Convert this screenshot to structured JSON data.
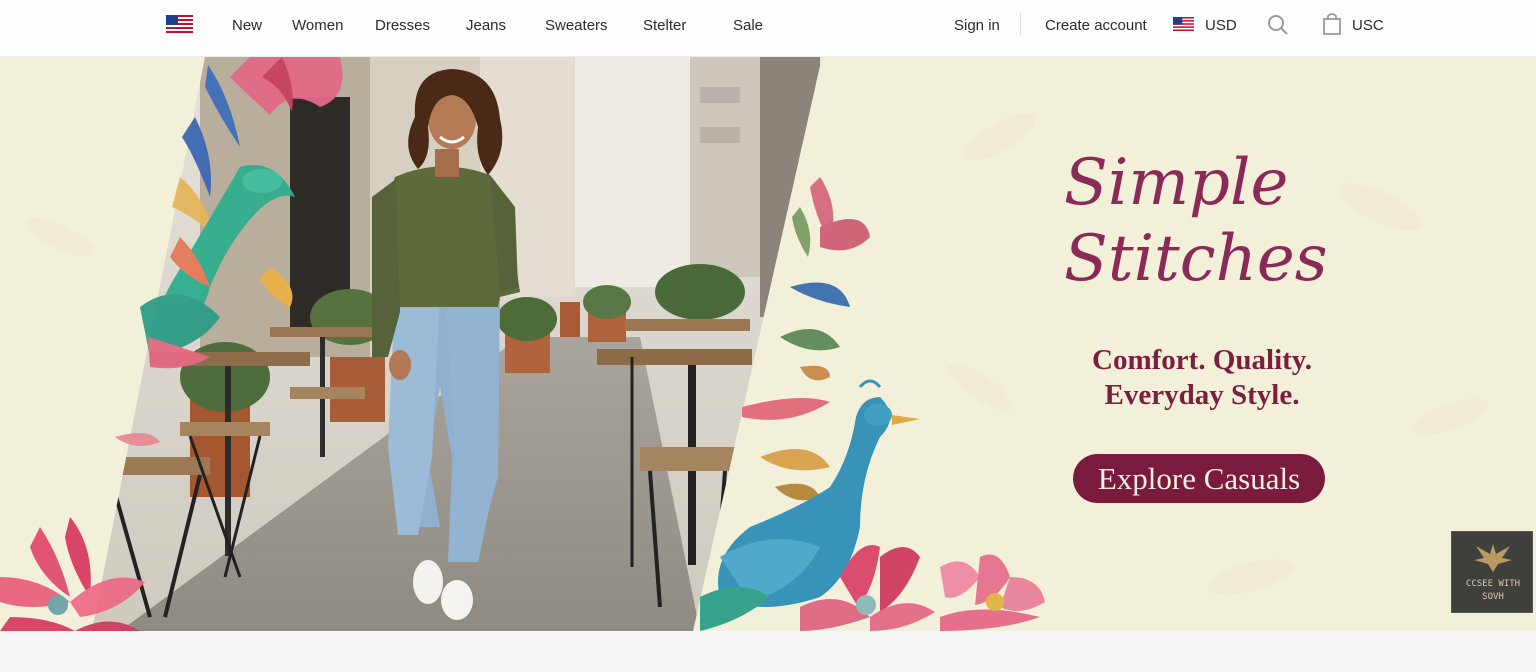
{
  "header": {
    "locale_flag": "us-flag-icon",
    "nav": [
      {
        "label": "New"
      },
      {
        "label": "Women"
      },
      {
        "label": "Dresses"
      },
      {
        "label": "Jeans"
      },
      {
        "label": "Sweaters"
      },
      {
        "label": "Stelter"
      },
      {
        "label": "Sale"
      }
    ],
    "sign_in": "Sign in",
    "create_account": "Create account",
    "currency": "USD",
    "search_icon": "search-icon",
    "bag_icon": "shopping-bag-icon",
    "bag_label": "USC"
  },
  "hero": {
    "title_line1": "Simple",
    "title_line2": "Stitches",
    "tagline_line1": "Comfort. Quality.",
    "tagline_line2": "Everyday Style.",
    "cta_label": "Explore Casuals",
    "colors": {
      "background": "#f3f0da",
      "title": "#8a2a56",
      "tagline": "#7a1f3f",
      "cta": "#7a1a3d"
    }
  },
  "badge": {
    "line1": "CCSEE WITH",
    "line2": "SOVH"
  }
}
